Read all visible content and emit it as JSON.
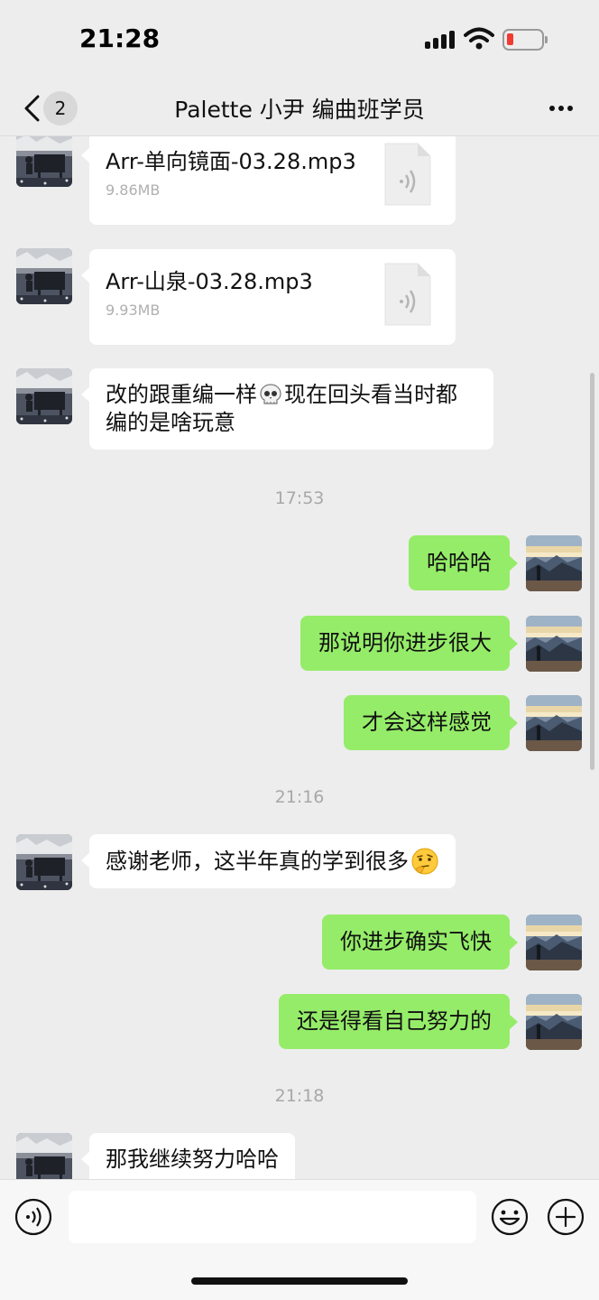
{
  "status_bar": {
    "time": "21:28"
  },
  "nav": {
    "unread_count": "2",
    "title": "Palette 小尹 编曲班学员"
  },
  "messages": [
    {
      "kind": "file",
      "sender": "other",
      "file_name": "Arr-单向镜面-03.28.mp3",
      "file_size": "9.86MB"
    },
    {
      "kind": "file",
      "sender": "other",
      "file_name": "Arr-山泉-03.28.mp3",
      "file_size": "9.93MB"
    },
    {
      "kind": "text",
      "sender": "other",
      "text_before_emoji": "改的跟重编一样",
      "emoji": "skull",
      "text_after_emoji": "现在回头看当时都",
      "text_line2": "编的是啥玩意"
    },
    {
      "kind": "time",
      "text": "17:53"
    },
    {
      "kind": "text",
      "sender": "me",
      "text": "哈哈哈"
    },
    {
      "kind": "text",
      "sender": "me",
      "text": "那说明你进步很大"
    },
    {
      "kind": "text",
      "sender": "me",
      "text": "才会这样感觉"
    },
    {
      "kind": "time",
      "text": "21:16"
    },
    {
      "kind": "text",
      "sender": "other",
      "text": "感谢老师，这半年真的学到很多",
      "emoji": "thinking-face"
    },
    {
      "kind": "text",
      "sender": "me",
      "text": "你进步确实飞快"
    },
    {
      "kind": "text",
      "sender": "me",
      "text": "还是得看自己努力的"
    },
    {
      "kind": "time",
      "text": "21:18"
    },
    {
      "kind": "text",
      "sender": "other",
      "text": "那我继续努力哈哈"
    }
  ],
  "input_bar": {
    "value": "",
    "icons": [
      "voice-icon",
      "emoji-icon",
      "plus-icon"
    ]
  },
  "colors": {
    "background": "#ededed",
    "outgoing_bubble": "#95ec69",
    "incoming_bubble": "#ffffff",
    "battery_low": "#f03b30"
  }
}
